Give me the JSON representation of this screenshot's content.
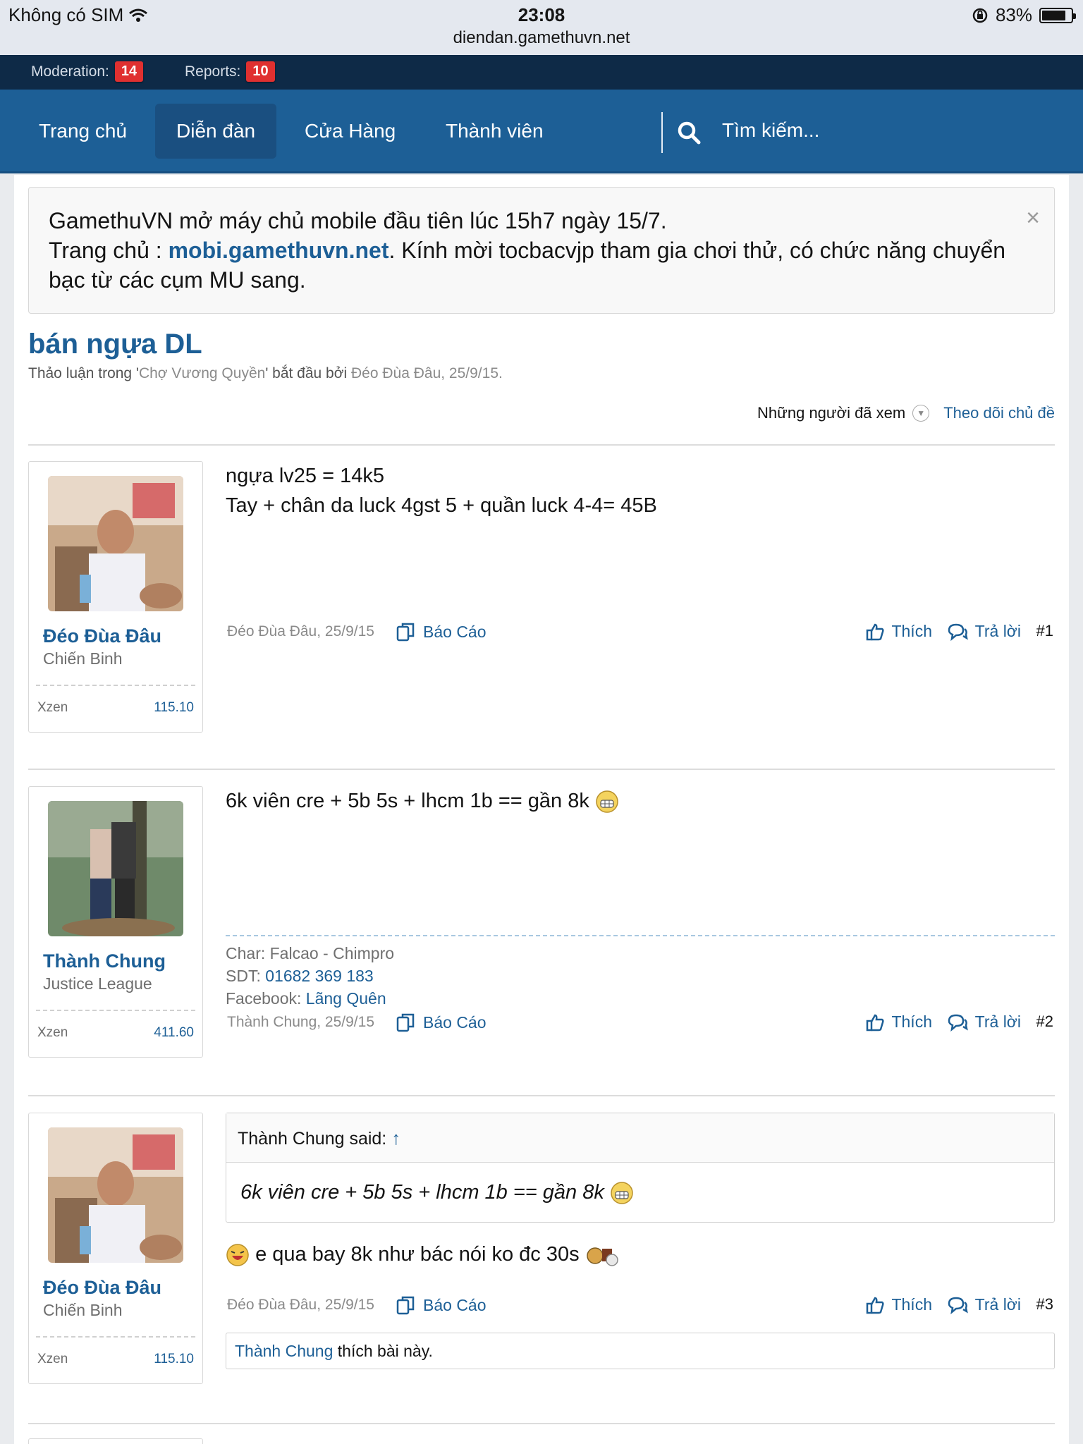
{
  "status_bar": {
    "carrier": "Không có SIM",
    "time": "23:08",
    "url": "diendan.gamethuvn.net",
    "battery": "83%",
    "battery_level": 0.83
  },
  "mod_bar": {
    "moderation_label": "Moderation:",
    "moderation_count": "14",
    "reports_label": "Reports:",
    "reports_count": "10"
  },
  "nav": {
    "tabs": [
      {
        "label": "Trang chủ"
      },
      {
        "label": "Diễn đàn"
      },
      {
        "label": "Cửa Hàng"
      },
      {
        "label": "Thành viên"
      }
    ],
    "active_tab": "Diễn đàn",
    "search_placeholder": "Tìm kiếm..."
  },
  "notice": {
    "line1": "GamethuVN mở máy chủ mobile đầu tiên lúc 15h7 ngày 15/7.",
    "line2_prefix": "Trang chủ : ",
    "link": "mobi.gamethuvn.net",
    "line2_suffix": ". Kính mời tocbacvjp tham gia chơi thử, có chức năng chuyển bạc từ các cụm MU sang.",
    "close": "×"
  },
  "thread": {
    "title": "bán ngựa DL",
    "meta_prefix": "Thảo luận trong '",
    "forum": "Chợ Vương Quyền",
    "meta_mid": "' bắt đầu bởi ",
    "starter": "Đéo Đùa Đâu",
    "meta_date": ", 25/9/15.",
    "viewers_label": "Những người đã xem",
    "watch_label": "Theo dõi chủ đề"
  },
  "posts": [
    {
      "username": "Đéo Đùa Đâu",
      "user_title": "Chiến Binh",
      "stat_label": "Xzen",
      "stat_value": "115.10",
      "lines": [
        "ngựa lv25 = 14k5",
        "Tay + chân da luck 4gst 5 + quần luck 4-4= 45B"
      ],
      "author_date": "Đéo Đùa Đâu, 25/9/15",
      "report": "Báo Cáo",
      "like": "Thích",
      "reply": "Trả lời",
      "number": "#1"
    },
    {
      "username": "Thành Chung",
      "user_title": "Justice League",
      "stat_label": "Xzen",
      "stat_value": "411.60",
      "lines": [
        "6k viên cre + 5b 5s + lhcm 1b == gần 8k"
      ],
      "signature": {
        "char": "Char: Falcao - Chimpro",
        "sdt_label": "SDT: ",
        "sdt_value": "01682 369 183",
        "fb_label": "Facebook: ",
        "fb_value": "Lãng Quên"
      },
      "author_date": "Thành Chung, 25/9/15",
      "report": "Báo Cáo",
      "like": "Thích",
      "reply": "Trả lời",
      "number": "#2"
    },
    {
      "username": "Đéo Đùa Đâu",
      "user_title": "Chiến Binh",
      "stat_label": "Xzen",
      "stat_value": "115.10",
      "quote": {
        "author": "Thành Chung said:",
        "arrow": "↑",
        "text": "6k viên cre + 5b 5s + lhcm 1b == gần 8k"
      },
      "lines": [
        "e qua bay 8k như bác nói ko đc 30s"
      ],
      "author_date": "Đéo Đùa Đâu, 25/9/15",
      "report": "Báo Cáo",
      "like": "Thích",
      "reply": "Trả lời",
      "number": "#3",
      "likes": {
        "user": "Thành Chung",
        "text": " thích bài này."
      }
    }
  ]
}
